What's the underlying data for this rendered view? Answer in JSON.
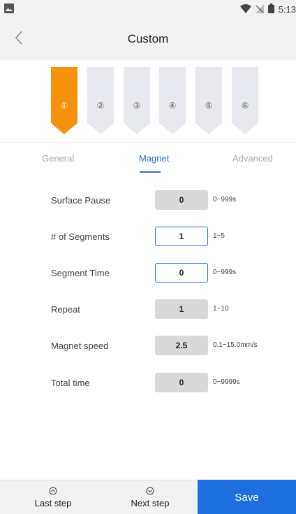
{
  "status_bar": {
    "time": "5:13",
    "icons": [
      "image-icon",
      "wifi-icon",
      "no-sim-icon",
      "battery-icon"
    ]
  },
  "header": {
    "title": "Custom",
    "back_icon": "chevron-left-icon"
  },
  "steps": {
    "items": [
      "①",
      "②",
      "③",
      "④",
      "⑤",
      "⑥"
    ],
    "active_index": 0,
    "active_color": "#f7900a",
    "inactive_color": "#e8e9ee"
  },
  "tabs": {
    "items": [
      "General",
      "Magnet",
      "Advanced"
    ],
    "active_index": 1,
    "accent_color": "#2f6fd6"
  },
  "rows": [
    {
      "label": "Surface Pause",
      "value": "0",
      "range": "0~999s",
      "editable": false
    },
    {
      "label": "# of Segments",
      "value": "1",
      "range": "1~5",
      "editable": true
    },
    {
      "label": "Segment Time",
      "value": "0",
      "range": "0~999s",
      "editable": true
    },
    {
      "label": "Repeat",
      "value": "1",
      "range": "1~10",
      "editable": false
    },
    {
      "label": "Magnet speed",
      "value": "2.5",
      "range": "0.1~15.0mm/s",
      "editable": false
    },
    {
      "label": "Total time",
      "value": "0",
      "range": "0~9999s",
      "editable": false
    }
  ],
  "bottom": {
    "last_step": "Last step",
    "next_step": "Next step",
    "save": "Save",
    "save_color": "#1f6fe0"
  }
}
